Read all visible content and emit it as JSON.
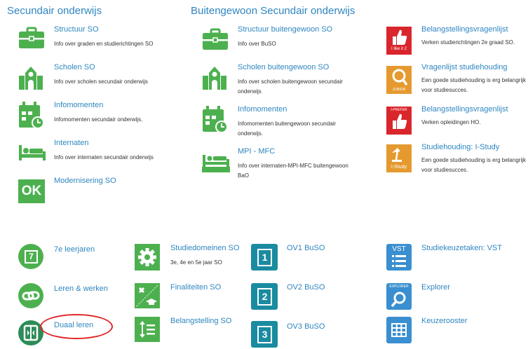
{
  "sections": {
    "secundair": "Secundair onderwijs",
    "buitengewoon": "Buitengewoon Secundair onderwijs"
  },
  "colors": {
    "title_blue": "#2f86c0",
    "green": "#4db04f",
    "dark_green": "#2e8b57",
    "teal": "#1a8ba0",
    "red": "#d9262c",
    "orange": "#e59a2f",
    "blue": "#3a8fd0",
    "highlight_red": "#e1262b"
  },
  "left": [
    {
      "title": "Structuur SO",
      "desc": "Info over graden en studierichtingen SO",
      "icon": "briefcase-icon"
    },
    {
      "title": "Scholen SO",
      "desc": "Info over scholen secundair onderwijs",
      "icon": "school-building-icon"
    },
    {
      "title": "Infomomenten",
      "desc": "Infomomenten secundair onderwijs.",
      "icon": "calendar-clock-icon"
    },
    {
      "title": "Internaten",
      "desc": "Info over internaten secundair onderwijs",
      "icon": "bed-icon"
    },
    {
      "title": "Modernisering SO",
      "desc": "",
      "icon": "ok-icon",
      "icon_text": "OK"
    }
  ],
  "middle": [
    {
      "title": "Structuur buitengewoon SO",
      "desc": "Info over BuSO",
      "icon": "briefcase-icon"
    },
    {
      "title": "Scholen buitengewoon SO",
      "desc": "Info over scholen buitengewoon secundair onderwijs",
      "icon": "school-building-icon"
    },
    {
      "title": "Infomomenten",
      "desc": "Infomomenten buitengewoon secundair onderwijs.",
      "icon": "calendar-clock-icon"
    },
    {
      "title": "MPI - MFC",
      "desc": "Info over internaten-MPI-MFC buitengewoon BaO",
      "icon": "mpi-mfc-bed-icon",
      "icon_text": "MPI - MFC"
    }
  ],
  "right": [
    {
      "title": "Belangstellingsvragenlijst",
      "desc": "Verken studierichtingen 2e graad SO.",
      "icon": "thumbs-up-icon",
      "icon_text": "I like it 2"
    },
    {
      "title": "Vragenlijst studiehouding",
      "desc": "Een goede studiehouding is erg belangrijk voor studiesucces.",
      "icon": "magnifier-study-icon",
      "icon_text": "JUNIOR"
    },
    {
      "title": "Belangstellingsvragenlijst",
      "desc": "Verken opleidingen HO.",
      "icon": "thumbs-up-icon",
      "icon_text": "I-PREFER"
    },
    {
      "title": "Studiehouding: I-Study",
      "desc": "Een goede studiehouding is erg belangrijk voor studiesucces.",
      "icon": "desk-lamp-icon",
      "icon_text": "I-Study"
    }
  ],
  "bottom": [
    {
      "title": "7e leerjaren",
      "icon": "number-7-icon",
      "icon_text": "7"
    },
    {
      "title": "Leren & werken",
      "icon": "link-icon"
    },
    {
      "title": "Duaal leren",
      "icon": "dual-learning-icon"
    },
    {
      "title": "Studiedomeinen SO",
      "desc": "3e, 4e en 5e jaar SO",
      "icon": "gear-icon"
    },
    {
      "title": "Finaliteiten SO",
      "icon": "tools-graduation-icon"
    },
    {
      "title": "Belangstelling SO",
      "icon": "arrows-lines-icon"
    },
    {
      "title": "OV1 BuSO",
      "icon": "ov1-icon",
      "icon_text": "1"
    },
    {
      "title": "OV2 BuSO",
      "icon": "ov2-icon",
      "icon_text": "2"
    },
    {
      "title": "OV3 BuSO",
      "icon": "ov3-icon",
      "icon_text": "3"
    },
    {
      "title": "Studiekeuzetaken: VST",
      "icon": "vst-list-icon",
      "icon_text": "VST"
    },
    {
      "title": "Explorer",
      "icon": "explorer-magnifier-icon",
      "icon_text": "EXPLORER"
    },
    {
      "title": "Keuzerooster",
      "icon": "grid-table-icon"
    }
  ]
}
